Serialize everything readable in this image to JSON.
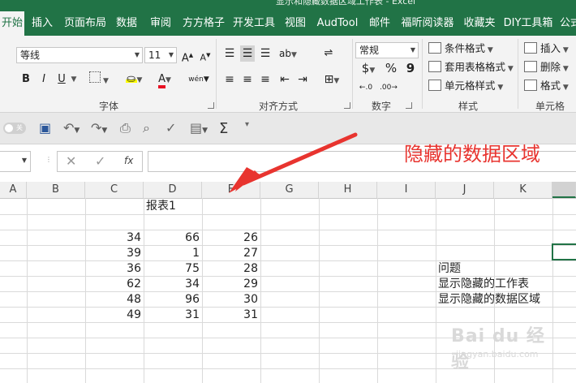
{
  "window": {
    "title": "显示和隐藏数据区域工作表 - Excel"
  },
  "tabs": [
    "开始",
    "插入",
    "页面布局",
    "数据",
    "审阅",
    "方方格子",
    "开发工具",
    "视图",
    "AudTool",
    "邮件",
    "福昕阅读器",
    "收藏夹",
    "DIY工具箱",
    "公式"
  ],
  "ribbon": {
    "font": {
      "name": "等线",
      "size": "11",
      "grow": "A",
      "shrink": "A",
      "bold": "B",
      "italic": "I",
      "underline": "U",
      "phonetic": "wén",
      "label": "字体"
    },
    "alignment": {
      "label": "对齐方式"
    },
    "number": {
      "format": "常规",
      "currency": "$",
      "percent": "%",
      "comma": "9",
      "label": "数字"
    },
    "styles": {
      "items": [
        "条件格式",
        "套用表格格式",
        "单元格样式"
      ],
      "label": "样式"
    },
    "cells": {
      "items": [
        "插入",
        "删除",
        "格式"
      ],
      "label": "单元格"
    }
  },
  "qat": {
    "toggle": "关"
  },
  "formula_bar": {
    "fx": "fx"
  },
  "columns": [
    "A",
    "B",
    "C",
    "D",
    "E",
    "F",
    "G",
    "H",
    "I",
    "J",
    "K"
  ],
  "annotation": "隐藏的数据区域",
  "sheet": {
    "title_cell": "报表1",
    "rows": [
      [
        "34",
        "66",
        "26"
      ],
      [
        "39",
        "1",
        "27"
      ],
      [
        "36",
        "75",
        "28"
      ],
      [
        "62",
        "34",
        "29"
      ],
      [
        "48",
        "96",
        "30"
      ],
      [
        "49",
        "31",
        "31"
      ]
    ],
    "notes": [
      "问题",
      "显示隐藏的工作表",
      "显示隐藏的数据区域"
    ]
  },
  "watermark": {
    "brand": "Bai du 经验",
    "url": "jingyan.baidu.com"
  },
  "colors": {
    "accent": "#217346",
    "annotation": "#e8342f",
    "grid": "#dadada"
  }
}
